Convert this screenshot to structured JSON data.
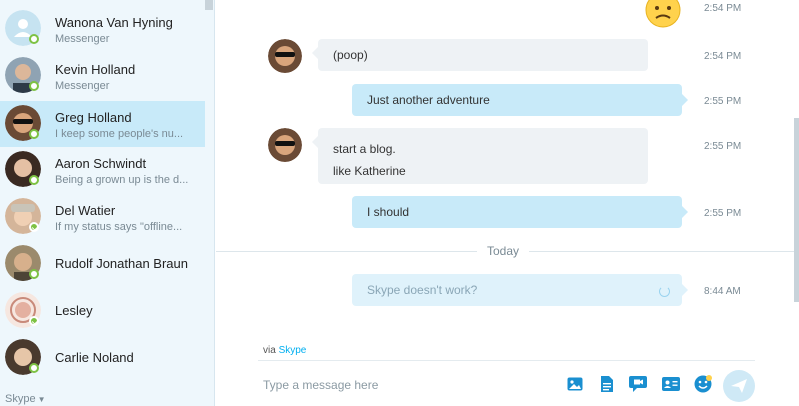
{
  "sidebar": {
    "contacts": [
      {
        "name": "Wanona Van Hyning",
        "sub": "Messenger"
      },
      {
        "name": "Kevin Holland",
        "sub": "Messenger"
      },
      {
        "name": "Greg Holland",
        "sub": "I keep some people's nu..."
      },
      {
        "name": "Aaron Schwindt",
        "sub": "Being a grown up is the d..."
      },
      {
        "name": "Del Watier",
        "sub": "If my status says \"offline..."
      },
      {
        "name": "Rudolf Jonathan Braun",
        "sub": ""
      },
      {
        "name": "Lesley",
        "sub": ""
      },
      {
        "name": "Carlie Noland",
        "sub": ""
      }
    ],
    "skype_menu_label": "Skype"
  },
  "chat": {
    "messages": [
      {
        "text": "",
        "time": "2:54 PM",
        "direction": "out",
        "emoji": "worried-face"
      },
      {
        "text": "(poop)",
        "time": "2:54 PM",
        "direction": "in"
      },
      {
        "text": "Just another adventure",
        "time": "2:55 PM",
        "direction": "out"
      },
      {
        "lines": [
          "start a blog.",
          "like Katherine"
        ],
        "time": "2:55 PM",
        "direction": "in"
      },
      {
        "text": "I should",
        "time": "2:55 PM",
        "direction": "out"
      },
      {
        "text": "Skype doesn't work?",
        "time": "8:44 AM",
        "direction": "out",
        "status": "sending"
      }
    ],
    "day_divider": "Today"
  },
  "composer": {
    "via_prefix": "via",
    "via_service": "Skype",
    "placeholder": "Type a message here"
  },
  "colors": {
    "accent": "#00aff0",
    "selected_contact_bg": "#c8eaf9",
    "online_green": "#7dc243"
  }
}
